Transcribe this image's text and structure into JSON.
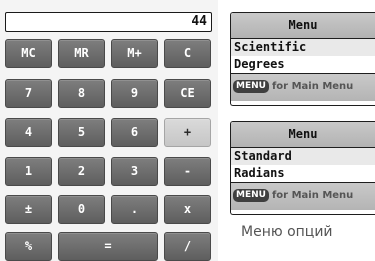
{
  "calculator": {
    "display_value": "44",
    "keys": [
      {
        "label": "MC",
        "name": "memory-clear-key"
      },
      {
        "label": "MR",
        "name": "memory-recall-key"
      },
      {
        "label": "M+",
        "name": "memory-add-key"
      },
      {
        "label": "C",
        "name": "clear-key"
      },
      {
        "label": "7",
        "name": "digit-7-key"
      },
      {
        "label": "8",
        "name": "digit-8-key"
      },
      {
        "label": "9",
        "name": "digit-9-key"
      },
      {
        "label": "CE",
        "name": "clear-entry-key"
      },
      {
        "label": "4",
        "name": "digit-4-key"
      },
      {
        "label": "5",
        "name": "digit-5-key"
      },
      {
        "label": "6",
        "name": "digit-6-key"
      },
      {
        "label": "+",
        "name": "plus-key",
        "style": "light"
      },
      {
        "label": "1",
        "name": "digit-1-key"
      },
      {
        "label": "2",
        "name": "digit-2-key"
      },
      {
        "label": "3",
        "name": "digit-3-key"
      },
      {
        "label": "-",
        "name": "minus-key"
      },
      {
        "label": "±",
        "name": "plus-minus-key"
      },
      {
        "label": "0",
        "name": "digit-0-key"
      },
      {
        "label": ".",
        "name": "decimal-key"
      },
      {
        "label": "x",
        "name": "multiply-key"
      },
      {
        "label": "%",
        "name": "percent-key"
      },
      {
        "label": "=",
        "name": "equals-key"
      },
      {
        "label": "/",
        "name": "divide-key"
      }
    ]
  },
  "menu_top": {
    "title": "Menu",
    "items": [
      "Scientific",
      "Degrees"
    ],
    "hint_key": "MENU",
    "hint_text": "for Main Menu"
  },
  "menu_bottom": {
    "title": "Menu",
    "items": [
      "Standard",
      "Radians"
    ],
    "hint_key": "MENU",
    "hint_text": "for Main Menu"
  },
  "caption": "Меню опций"
}
